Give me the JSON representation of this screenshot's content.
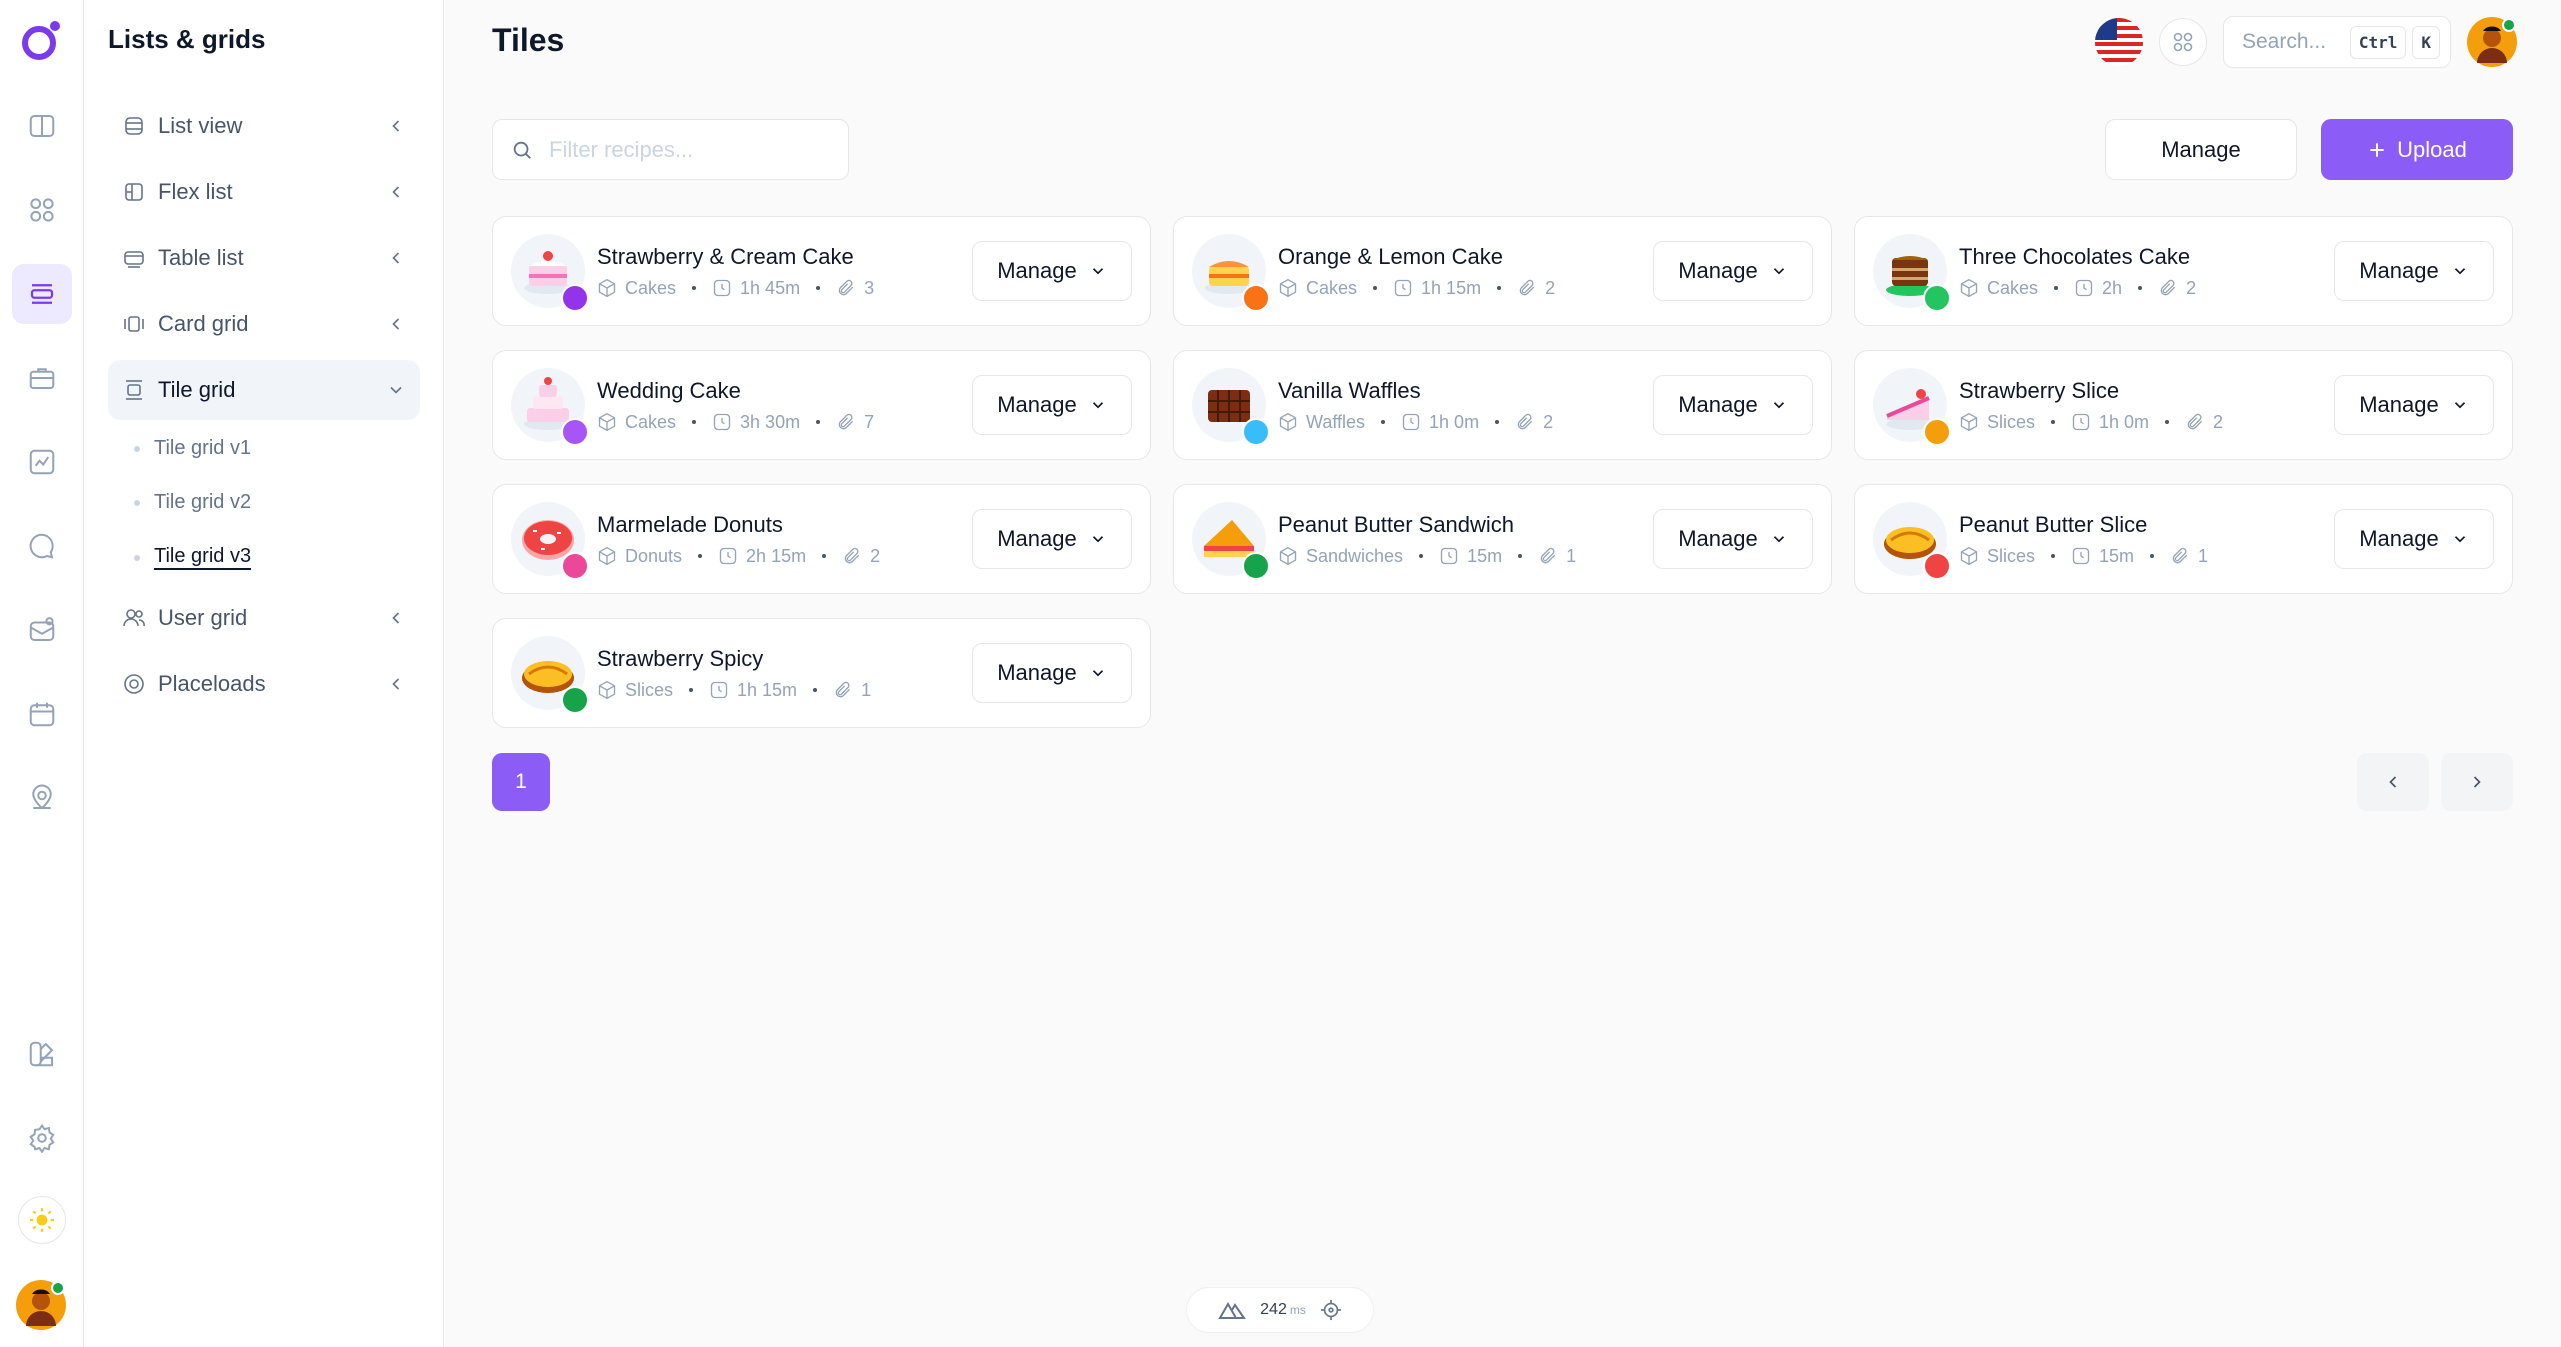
{
  "sidebar": {
    "title": "Lists & grids",
    "items": [
      {
        "label": "List view"
      },
      {
        "label": "Flex list"
      },
      {
        "label": "Table list"
      },
      {
        "label": "Card grid"
      },
      {
        "label": "Tile grid"
      },
      {
        "label": "User grid"
      },
      {
        "label": "Placeloads"
      }
    ],
    "subitems": [
      {
        "label": "Tile grid v1"
      },
      {
        "label": "Tile grid v2"
      },
      {
        "label": "Tile grid v3"
      }
    ]
  },
  "header": {
    "title": "Tiles",
    "search_placeholder": "Search...",
    "kbd_ctrl": "Ctrl",
    "kbd_k": "K"
  },
  "toolbar": {
    "filter_placeholder": "Filter recipes...",
    "manage_label": "Manage",
    "upload_label": "Upload"
  },
  "tiles": [
    {
      "name": "Strawberry & Cream Cake",
      "category": "Cakes",
      "time": "1h 45m",
      "attachments": "3",
      "manage": "Manage",
      "food": "cake-pink",
      "dot": "#9333ea"
    },
    {
      "name": "Orange & Lemon Cake",
      "category": "Cakes",
      "time": "1h 15m",
      "attachments": "2",
      "manage": "Manage",
      "food": "cake-orange",
      "dot": "#f97316"
    },
    {
      "name": "Three Chocolates Cake",
      "category": "Cakes",
      "time": "2h",
      "attachments": "2",
      "manage": "Manage",
      "food": "cake-choc",
      "dot": "#22c55e"
    },
    {
      "name": "Wedding Cake",
      "category": "Cakes",
      "time": "3h 30m",
      "attachments": "7",
      "manage": "Manage",
      "food": "cake-wedding",
      "dot": "#a855f7"
    },
    {
      "name": "Vanilla Waffles",
      "category": "Waffles",
      "time": "1h 0m",
      "attachments": "2",
      "manage": "Manage",
      "food": "waffle",
      "dot": "#38bdf8"
    },
    {
      "name": "Strawberry Slice",
      "category": "Slices",
      "time": "1h 0m",
      "attachments": "2",
      "manage": "Manage",
      "food": "slice-pink",
      "dot": "#f59e0b"
    },
    {
      "name": "Marmelade Donuts",
      "category": "Donuts",
      "time": "2h 15m",
      "attachments": "2",
      "manage": "Manage",
      "food": "donut",
      "dot": "#ec4899"
    },
    {
      "name": "Peanut Butter Sandwich",
      "category": "Sandwiches",
      "time": "15m",
      "attachments": "1",
      "manage": "Manage",
      "food": "sandwich",
      "dot": "#16a34a"
    },
    {
      "name": "Peanut Butter Slice",
      "category": "Slices",
      "time": "15m",
      "attachments": "1",
      "manage": "Manage",
      "food": "bread",
      "dot": "#ef4444"
    },
    {
      "name": "Strawberry Spicy",
      "category": "Slices",
      "time": "1h 15m",
      "attachments": "1",
      "manage": "Manage",
      "food": "bread",
      "dot": "#16a34a"
    }
  ],
  "pagination": {
    "current": "1"
  },
  "perf": {
    "value": "242",
    "unit": "ms"
  },
  "colors": {
    "accent": "#8b5cf6",
    "accent_light": "#ede9fe"
  }
}
